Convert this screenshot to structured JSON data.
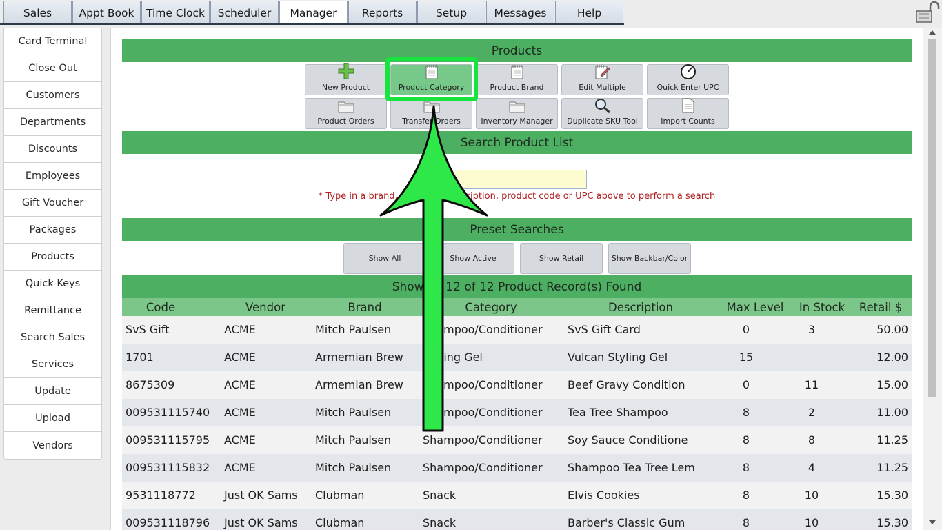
{
  "tabs": [
    "Sales",
    "Appt Book",
    "Time Clock",
    "Scheduler",
    "Manager",
    "Reports",
    "Setup",
    "Messages",
    "Help"
  ],
  "active_tab": "Manager",
  "sidebar": [
    "Card Terminal",
    "Close Out",
    "Customers",
    "Departments",
    "Discounts",
    "Employees",
    "Gift Voucher",
    "Packages",
    "Products",
    "Quick Keys",
    "Remittance",
    "Search Sales",
    "Services",
    "Update",
    "Upload",
    "Vendors"
  ],
  "products_section": {
    "title": "Products",
    "tools": [
      {
        "label": "New Product",
        "icon": "plus-icon"
      },
      {
        "label": "Product Category",
        "icon": "notepad-icon"
      },
      {
        "label": "Product Brand",
        "icon": "notepad-icon"
      },
      {
        "label": "Edit Multiple",
        "icon": "edit-notepad-icon"
      },
      {
        "label": "Quick Enter UPC",
        "icon": "gauge-icon"
      },
      {
        "label": "Product Orders",
        "icon": "folder-icon"
      },
      {
        "label": "Transfer Orders",
        "icon": "folder-icon"
      },
      {
        "label": "Inventory Manager",
        "icon": "folder-icon"
      },
      {
        "label": "Duplicate SKU Tool",
        "icon": "magnifier-icon"
      },
      {
        "label": "Import Counts",
        "icon": "document-icon"
      }
    ]
  },
  "search_section": {
    "title": "Search Product List",
    "input_value": "",
    "hint": "* Type in a brand, category, description, product code or UPC above to perform a search"
  },
  "preset_section": {
    "title": "Preset Searches",
    "buttons": [
      "Show All",
      "Show Active",
      "Show Retail",
      "Show Backbar/Color"
    ]
  },
  "results": {
    "summary": "Showing 12 of 12 Product Record(s) Found",
    "columns": [
      "Code",
      "Vendor",
      "Brand",
      "Category",
      "Description",
      "Max Level",
      "In Stock",
      "Retail $"
    ],
    "rows": [
      [
        "SvS Gift",
        "ACME",
        "Mitch Paulsen",
        "Shampoo/Conditioner",
        "SvS Gift Card",
        "0",
        "3",
        "50.00"
      ],
      [
        "1701",
        "ACME",
        "Armemian Brew",
        "Styling Gel",
        "Vulcan Styling Gel",
        "15",
        "",
        "12.00"
      ],
      [
        "8675309",
        "ACME",
        "Armemian Brew",
        "Shampoo/Conditioner",
        "Beef Gravy Condition",
        "0",
        "11",
        "15.00"
      ],
      [
        "009531115740",
        "ACME",
        "Mitch Paulsen",
        "Shampoo/Conditioner",
        "Tea Tree Shampoo",
        "8",
        "2",
        "11.00"
      ],
      [
        "009531115795",
        "ACME",
        "Mitch Paulsen",
        "Shampoo/Conditioner",
        "Soy Sauce Conditione",
        "8",
        "8",
        "11.25"
      ],
      [
        "009531115832",
        "ACME",
        "Mitch Paulsen",
        "Shampoo/Conditioner",
        "Shampoo Tea Tree Lem",
        "8",
        "4",
        "11.25"
      ],
      [
        "9531118772",
        "Just OK Sams",
        "Clubman",
        "Snack",
        "Elvis Cookies",
        "8",
        "10",
        "15.30"
      ],
      [
        "009531118796",
        "Just OK Sams",
        "Clubman",
        "Snack",
        "Barber's Classic Gum",
        "8",
        "10",
        "15.30"
      ]
    ]
  },
  "colors": {
    "section_green": "#4caf62",
    "header_green": "#7cc68a",
    "highlight_green": "#19e33f",
    "hint_red": "#b02020"
  }
}
